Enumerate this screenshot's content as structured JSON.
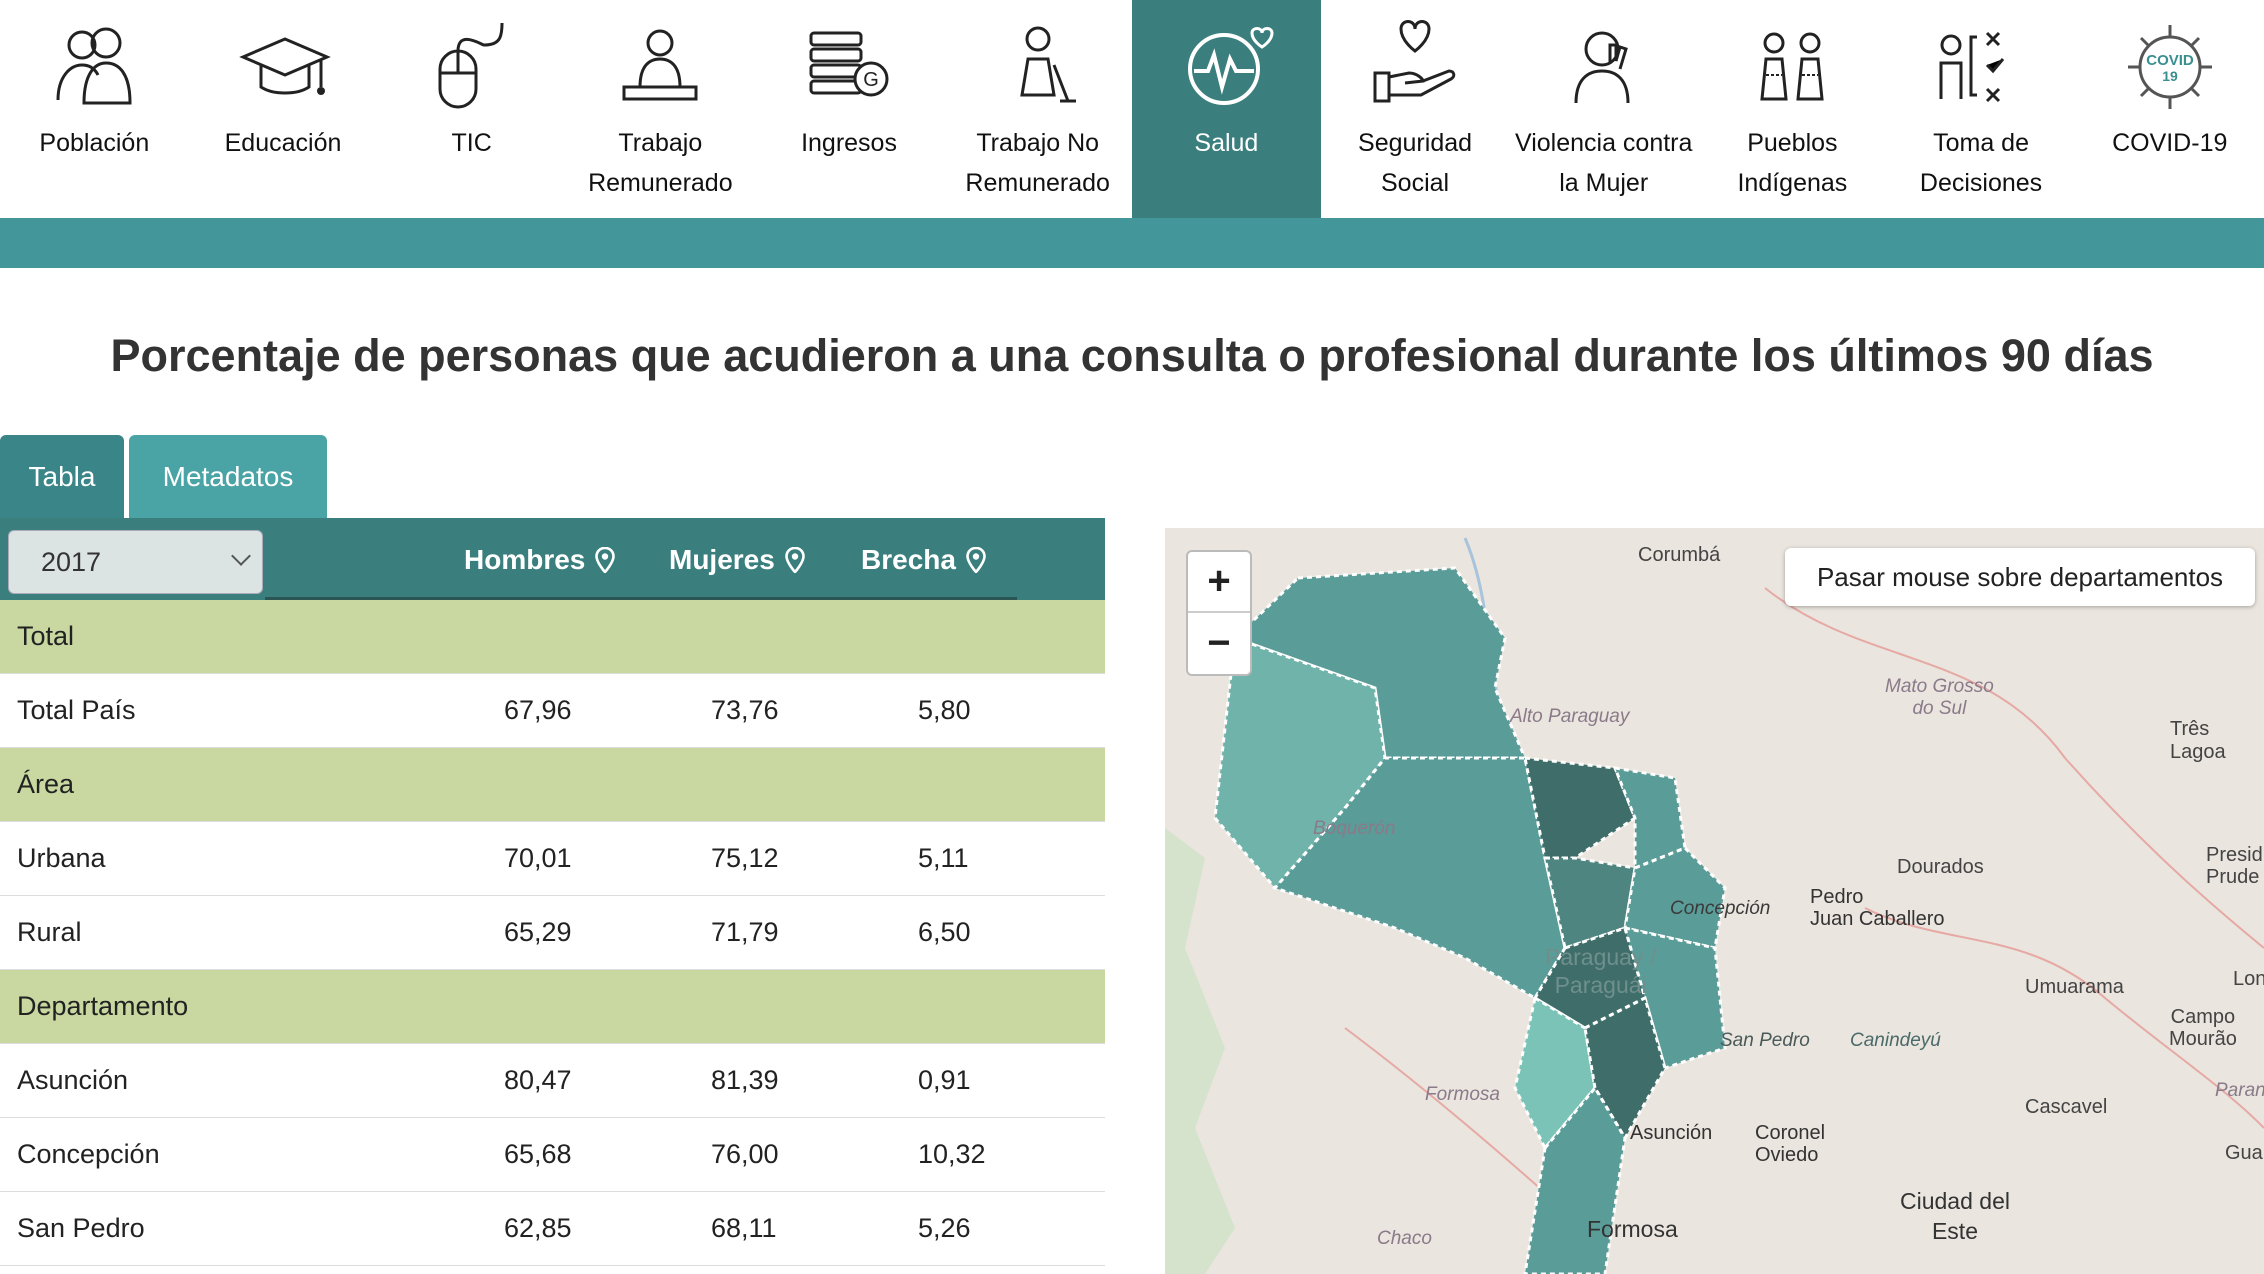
{
  "nav": [
    {
      "label": "Población",
      "icon": "people-icon"
    },
    {
      "label": "Educación",
      "icon": "graduation-cap-icon"
    },
    {
      "label": "TIC",
      "icon": "mouse-icon"
    },
    {
      "label": "Trabajo\nRemunerado",
      "icon": "worker-desk-icon"
    },
    {
      "label": "Ingresos",
      "icon": "money-stack-icon"
    },
    {
      "label": "Trabajo No\nRemunerado",
      "icon": "cleaning-woman-icon"
    },
    {
      "label": "Salud",
      "icon": "heartbeat-icon",
      "active": true
    },
    {
      "label": "Seguridad\nSocial",
      "icon": "heart-hand-icon"
    },
    {
      "label": "Violencia contra\nla Mujer",
      "icon": "woman-stop-icon"
    },
    {
      "label": "Pueblos\nIndígenas",
      "icon": "indigenous-people-icon"
    },
    {
      "label": "Toma de\nDecisiones",
      "icon": "decision-checklist-icon"
    },
    {
      "label": "COVID-19",
      "icon": "covid-virus-icon"
    }
  ],
  "title": "Porcentaje de personas que acudieron a una consulta o profesional durante los últimos 90 días",
  "tabs": {
    "tabla": "Tabla",
    "metadatos": "Metadatos"
  },
  "table": {
    "year": "2017",
    "headers": {
      "hombres": "Hombres",
      "mujeres": "Mujeres",
      "brecha": "Brecha"
    },
    "rows": [
      {
        "label": "Total",
        "section": true
      },
      {
        "label": "Total País",
        "hombres": "67,96",
        "mujeres": "73,76",
        "brecha": "5,80"
      },
      {
        "label": "Área",
        "section": true
      },
      {
        "label": "Urbana",
        "hombres": "70,01",
        "mujeres": "75,12",
        "brecha": "5,11"
      },
      {
        "label": "Rural",
        "hombres": "65,29",
        "mujeres": "71,79",
        "brecha": "6,50"
      },
      {
        "label": "Departamento",
        "section": true
      },
      {
        "label": "Asunción",
        "hombres": "80,47",
        "mujeres": "81,39",
        "brecha": "0,91"
      },
      {
        "label": "Concepción",
        "hombres": "65,68",
        "mujeres": "76,00",
        "brecha": "10,32"
      },
      {
        "label": "San Pedro",
        "hombres": "62,85",
        "mujeres": "68,11",
        "brecha": "5,26"
      }
    ]
  },
  "map": {
    "hint": "Pasar mouse sobre departamentos",
    "zoom_in": "+",
    "zoom_out": "−",
    "labels": {
      "corumba": "Corumbá",
      "mato_grosso": "Mato Grosso\ndo Sul",
      "tres_lagoas": "Três Lagoa",
      "alto_paraguay": "Alto Paraguay",
      "boqueron": "Boquerón",
      "dourados": "Dourados",
      "presid": "Presid\nPrude",
      "concepcion": "Concepción",
      "pedro": "Pedro\nJuan Caballero",
      "paraguay": "Paraguay /\nParaguái",
      "umuarama": "Umuarama",
      "lon": "Lon",
      "campo": "Campo\nMourão",
      "san_pedro": "San Pedro",
      "canindeyu": "Canindeyú",
      "formosa_it": "Formosa",
      "parana": "Paraná",
      "cascavel": "Cascavel",
      "asuncion": "Asunción",
      "coronel": "Coronel\nOviedo",
      "guarap": "Guarap",
      "ciudad": "Ciudad del\nEste",
      "chaco": "Chaco",
      "formosa": "Formosa"
    }
  }
}
